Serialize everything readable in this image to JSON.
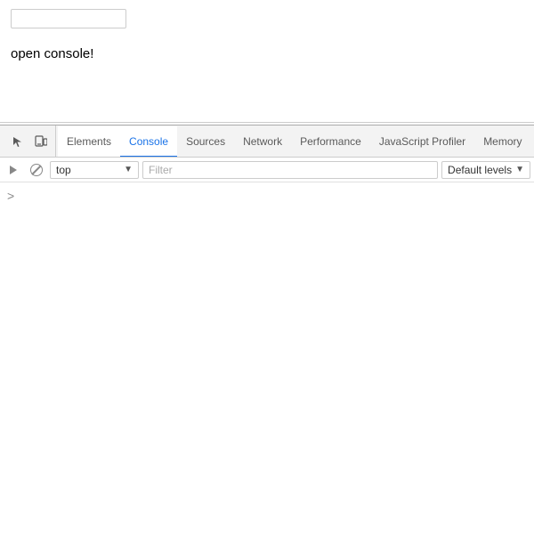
{
  "page": {
    "url_bar_placeholder": "",
    "heading": "open console!"
  },
  "devtools": {
    "tabs": [
      {
        "id": "elements",
        "label": "Elements",
        "active": false
      },
      {
        "id": "console",
        "label": "Console",
        "active": true
      },
      {
        "id": "sources",
        "label": "Sources",
        "active": false
      },
      {
        "id": "network",
        "label": "Network",
        "active": false
      },
      {
        "id": "performance",
        "label": "Performance",
        "active": false
      },
      {
        "id": "js-profiler",
        "label": "JavaScript Profiler",
        "active": false
      },
      {
        "id": "memory",
        "label": "Memory",
        "active": false
      }
    ],
    "toolbar": {
      "context_label": "top",
      "filter_placeholder": "Filter",
      "levels_label": "Default levels"
    },
    "console": {
      "prompt_char": ">"
    }
  }
}
